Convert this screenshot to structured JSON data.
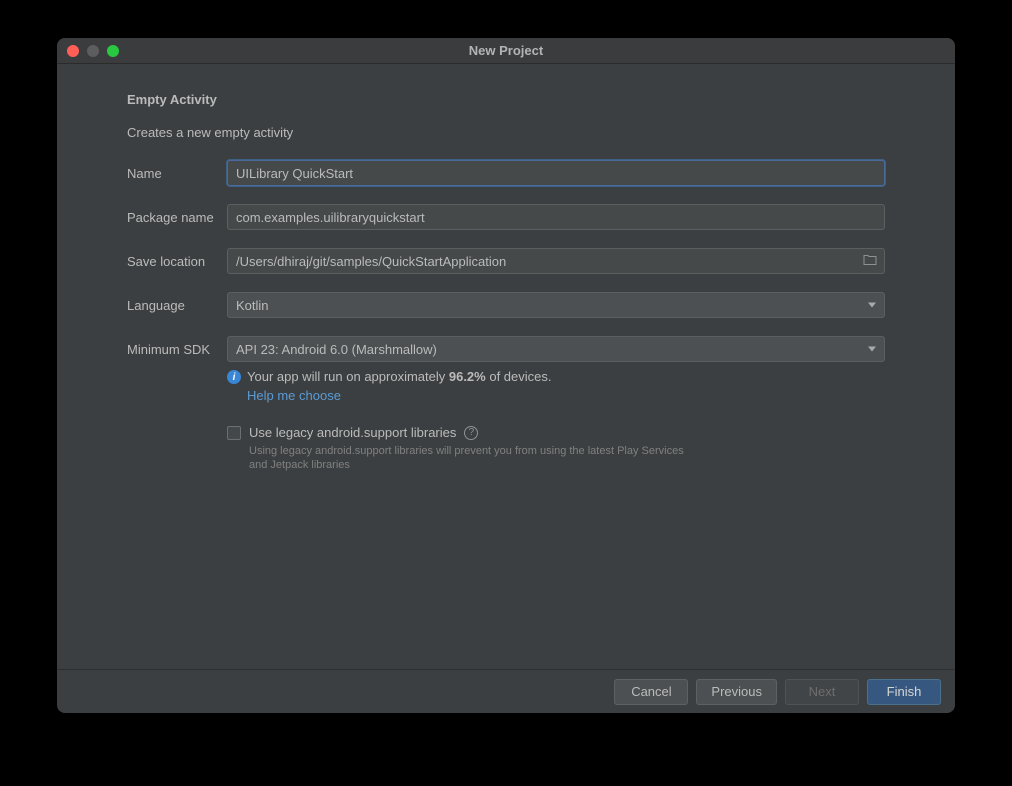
{
  "window": {
    "title": "New Project"
  },
  "header": {
    "section_title": "Empty Activity",
    "section_sub": "Creates a new empty activity"
  },
  "form": {
    "name_label": "Name",
    "name_value": "UILibrary QuickStart",
    "package_label": "Package name",
    "package_value": "com.examples.uilibraryquickstart",
    "save_label": "Save location",
    "save_value": "/Users/dhiraj/git/samples/QuickStartApplication",
    "language_label": "Language",
    "language_value": "Kotlin",
    "minsdk_label": "Minimum SDK",
    "minsdk_value": "API 23: Android 6.0 (Marshmallow)"
  },
  "info": {
    "text_prefix": "Your app will run on approximately ",
    "percentage": "96.2%",
    "text_suffix": " of devices.",
    "help_link": "Help me choose"
  },
  "legacy": {
    "checkbox_label": "Use legacy android.support libraries",
    "sub": "Using legacy android.support libraries will prevent you from using the latest Play Services and Jetpack libraries"
  },
  "footer": {
    "cancel": "Cancel",
    "previous": "Previous",
    "next": "Next",
    "finish": "Finish"
  }
}
